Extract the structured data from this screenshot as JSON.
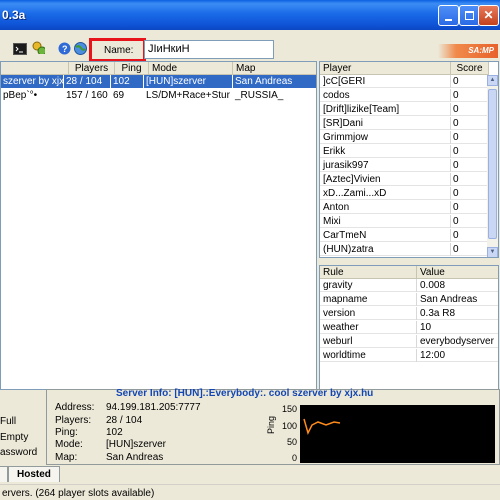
{
  "window": {
    "title": "0.3a"
  },
  "toolbar": {
    "name_label": "Name:",
    "name_value": "JIиНкиН",
    "logo_text": "SA:MP"
  },
  "server_list": {
    "columns": [
      "Players",
      "Ping",
      "Mode",
      "Map"
    ],
    "rows": [
      {
        "hostname": "szerver by xjx",
        "players": "28 / 104",
        "ping": "102",
        "mode": "[HUN]szerver",
        "map": "San Andreas",
        "selected": true
      },
      {
        "hostname": "pBep`°•",
        "players": "157 / 160",
        "ping": "69",
        "mode": "LS/DM+Race+Stur",
        "map": "_RUSSIA_",
        "selected": false
      }
    ]
  },
  "players": {
    "columns": [
      "Player",
      "Score"
    ],
    "rows": [
      {
        "name": "]cC[GERI",
        "score": "0"
      },
      {
        "name": "codos",
        "score": "0"
      },
      {
        "name": "[Drift]lizike[Team]",
        "score": "0"
      },
      {
        "name": "[SR]Dani",
        "score": "0"
      },
      {
        "name": "Grimmjow",
        "score": "0"
      },
      {
        "name": "Erikk",
        "score": "0"
      },
      {
        "name": "jurasik997",
        "score": "0"
      },
      {
        "name": "[Aztec]Vivien",
        "score": "0"
      },
      {
        "name": "xD...Zami...xD",
        "score": "0"
      },
      {
        "name": "Anton",
        "score": "0"
      },
      {
        "name": "Mixi",
        "score": "0"
      },
      {
        "name": "CarTmeN",
        "score": "0"
      },
      {
        "name": "(HUN)zatra",
        "score": "0"
      }
    ]
  },
  "rules": {
    "columns": [
      "Rule",
      "Value"
    ],
    "rows": [
      {
        "rule": "gravity",
        "value": "0.008"
      },
      {
        "rule": "mapname",
        "value": "San Andreas"
      },
      {
        "rule": "version",
        "value": "0.3a R8"
      },
      {
        "rule": "weather",
        "value": "10"
      },
      {
        "rule": "weburl",
        "value": "everybodyserver"
      },
      {
        "rule": "worldtime",
        "value": "12:00"
      }
    ]
  },
  "filters": {
    "full": "Full",
    "empty": "Empty",
    "password": "assword"
  },
  "server_info": {
    "title": "Server Info: [HUN].:Everybody:. cool szerver by xjx.hu",
    "address_label": "Address:",
    "address": "94.199.181.205:7777",
    "players_label": "Players:",
    "players": "28 / 104",
    "ping_label": "Ping:",
    "ping": "102",
    "mode_label": "Mode:",
    "mode": "[HUN]szerver",
    "map_label": "Map:",
    "map": "San Andreas"
  },
  "ping_graph": {
    "ylabel": "Ping",
    "ticks": [
      "150",
      "100",
      "50",
      "0"
    ]
  },
  "tabs": {
    "hosted": "Hosted"
  },
  "status": {
    "text": "ervers. (264 player slots available)"
  }
}
